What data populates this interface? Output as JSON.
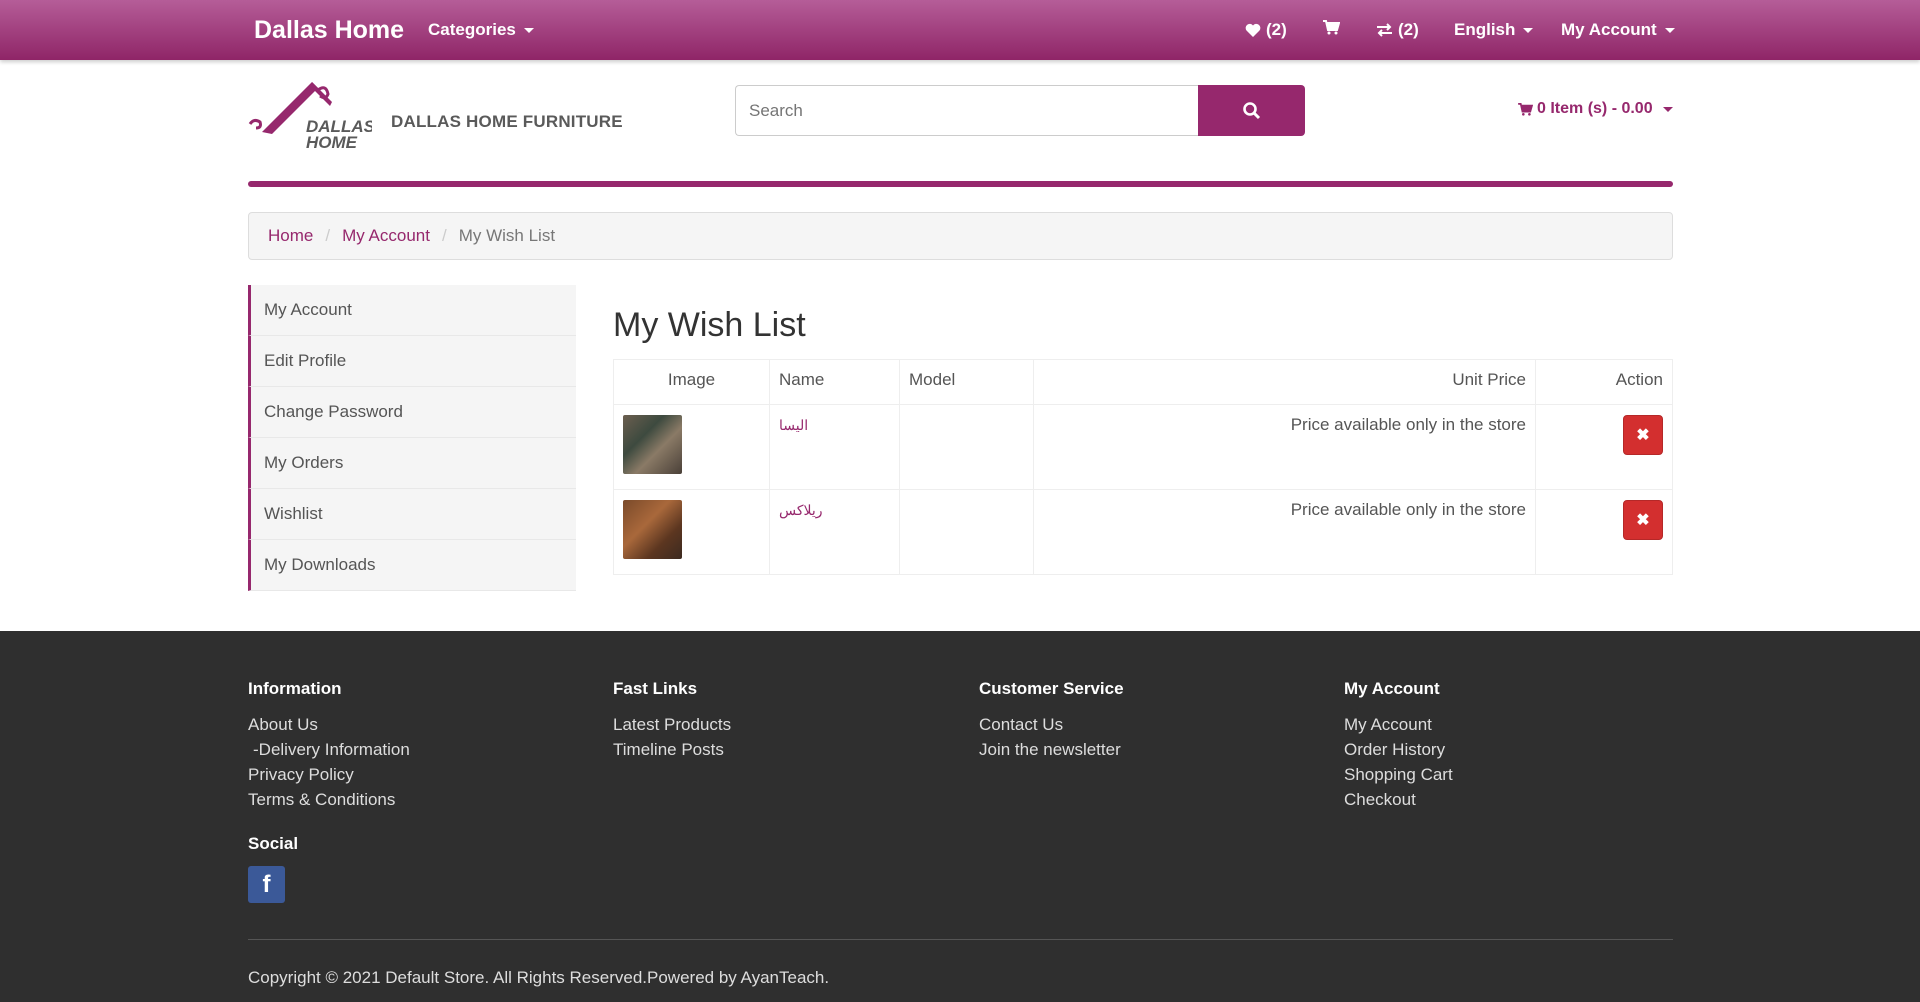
{
  "topbar": {
    "brand": "Dallas Home",
    "categories_label": "Categories",
    "wishlist_count": "(2)",
    "compare_count": "(2)",
    "language_label": "English",
    "account_label": "My Account"
  },
  "header": {
    "store_name": "DALLAS HOME FURNITURE",
    "logo_text_line1": "DALLAS",
    "logo_text_line2": "HOME",
    "search_placeholder": "Search",
    "cart_summary": "0 Item (s) - 0.00"
  },
  "breadcrumb": {
    "home": "Home",
    "account": "My Account",
    "current": "My Wish List"
  },
  "sidebar": {
    "items": [
      {
        "label": "My Account"
      },
      {
        "label": "Edit Profile"
      },
      {
        "label": "Change Password"
      },
      {
        "label": "My Orders"
      },
      {
        "label": "Wishlist"
      },
      {
        "label": "My Downloads"
      }
    ]
  },
  "main": {
    "title": "My Wish List",
    "columns": {
      "image": "Image",
      "name": "Name",
      "model": "Model",
      "unit_price": "Unit Price",
      "action": "Action"
    },
    "rows": [
      {
        "name": "اليسا",
        "model": "",
        "price": "Price available only in the store"
      },
      {
        "name": "ريلاكس",
        "model": "",
        "price": "Price available only in the store"
      }
    ]
  },
  "footer": {
    "information": {
      "title": "Information",
      "links": [
        "About Us",
        "-Delivery Information",
        "Privacy Policy",
        "Terms & Conditions"
      ]
    },
    "fast_links": {
      "title": "Fast Links",
      "links": [
        "Latest Products",
        "Timeline Posts"
      ]
    },
    "customer_service": {
      "title": "Customer Service",
      "links": [
        "Contact Us",
        "Join the newsletter"
      ]
    },
    "my_account": {
      "title": "My Account",
      "links": [
        "My Account",
        "Order History",
        "Shopping Cart",
        "Checkout"
      ]
    },
    "social_title": "Social",
    "facebook_glyph": "f",
    "copyright": "Copyright © 2021 Default Store. All Rights Reserved.Powered by AyanTeach."
  },
  "colors": {
    "brand": "#96286d",
    "remove": "#d32f2f",
    "footer_bg": "#2f2f2f",
    "facebook": "#3b5998"
  }
}
